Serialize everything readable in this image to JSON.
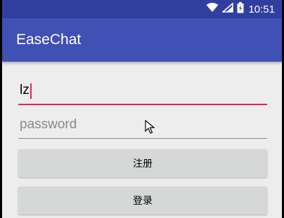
{
  "status_bar": {
    "time": "10:51",
    "icons": [
      "wifi-icon",
      "signal-icon",
      "battery-icon"
    ]
  },
  "app_bar": {
    "title": "EaseChat"
  },
  "form": {
    "username_value": "lz",
    "password_placeholder": "password",
    "register_label": "注册",
    "login_label": "登录"
  },
  "colors": {
    "status_bar": "#303f9f",
    "app_bar": "#3f51b5",
    "accent": "#e91e63",
    "background": "#ededed",
    "button": "#d6d7d7"
  }
}
